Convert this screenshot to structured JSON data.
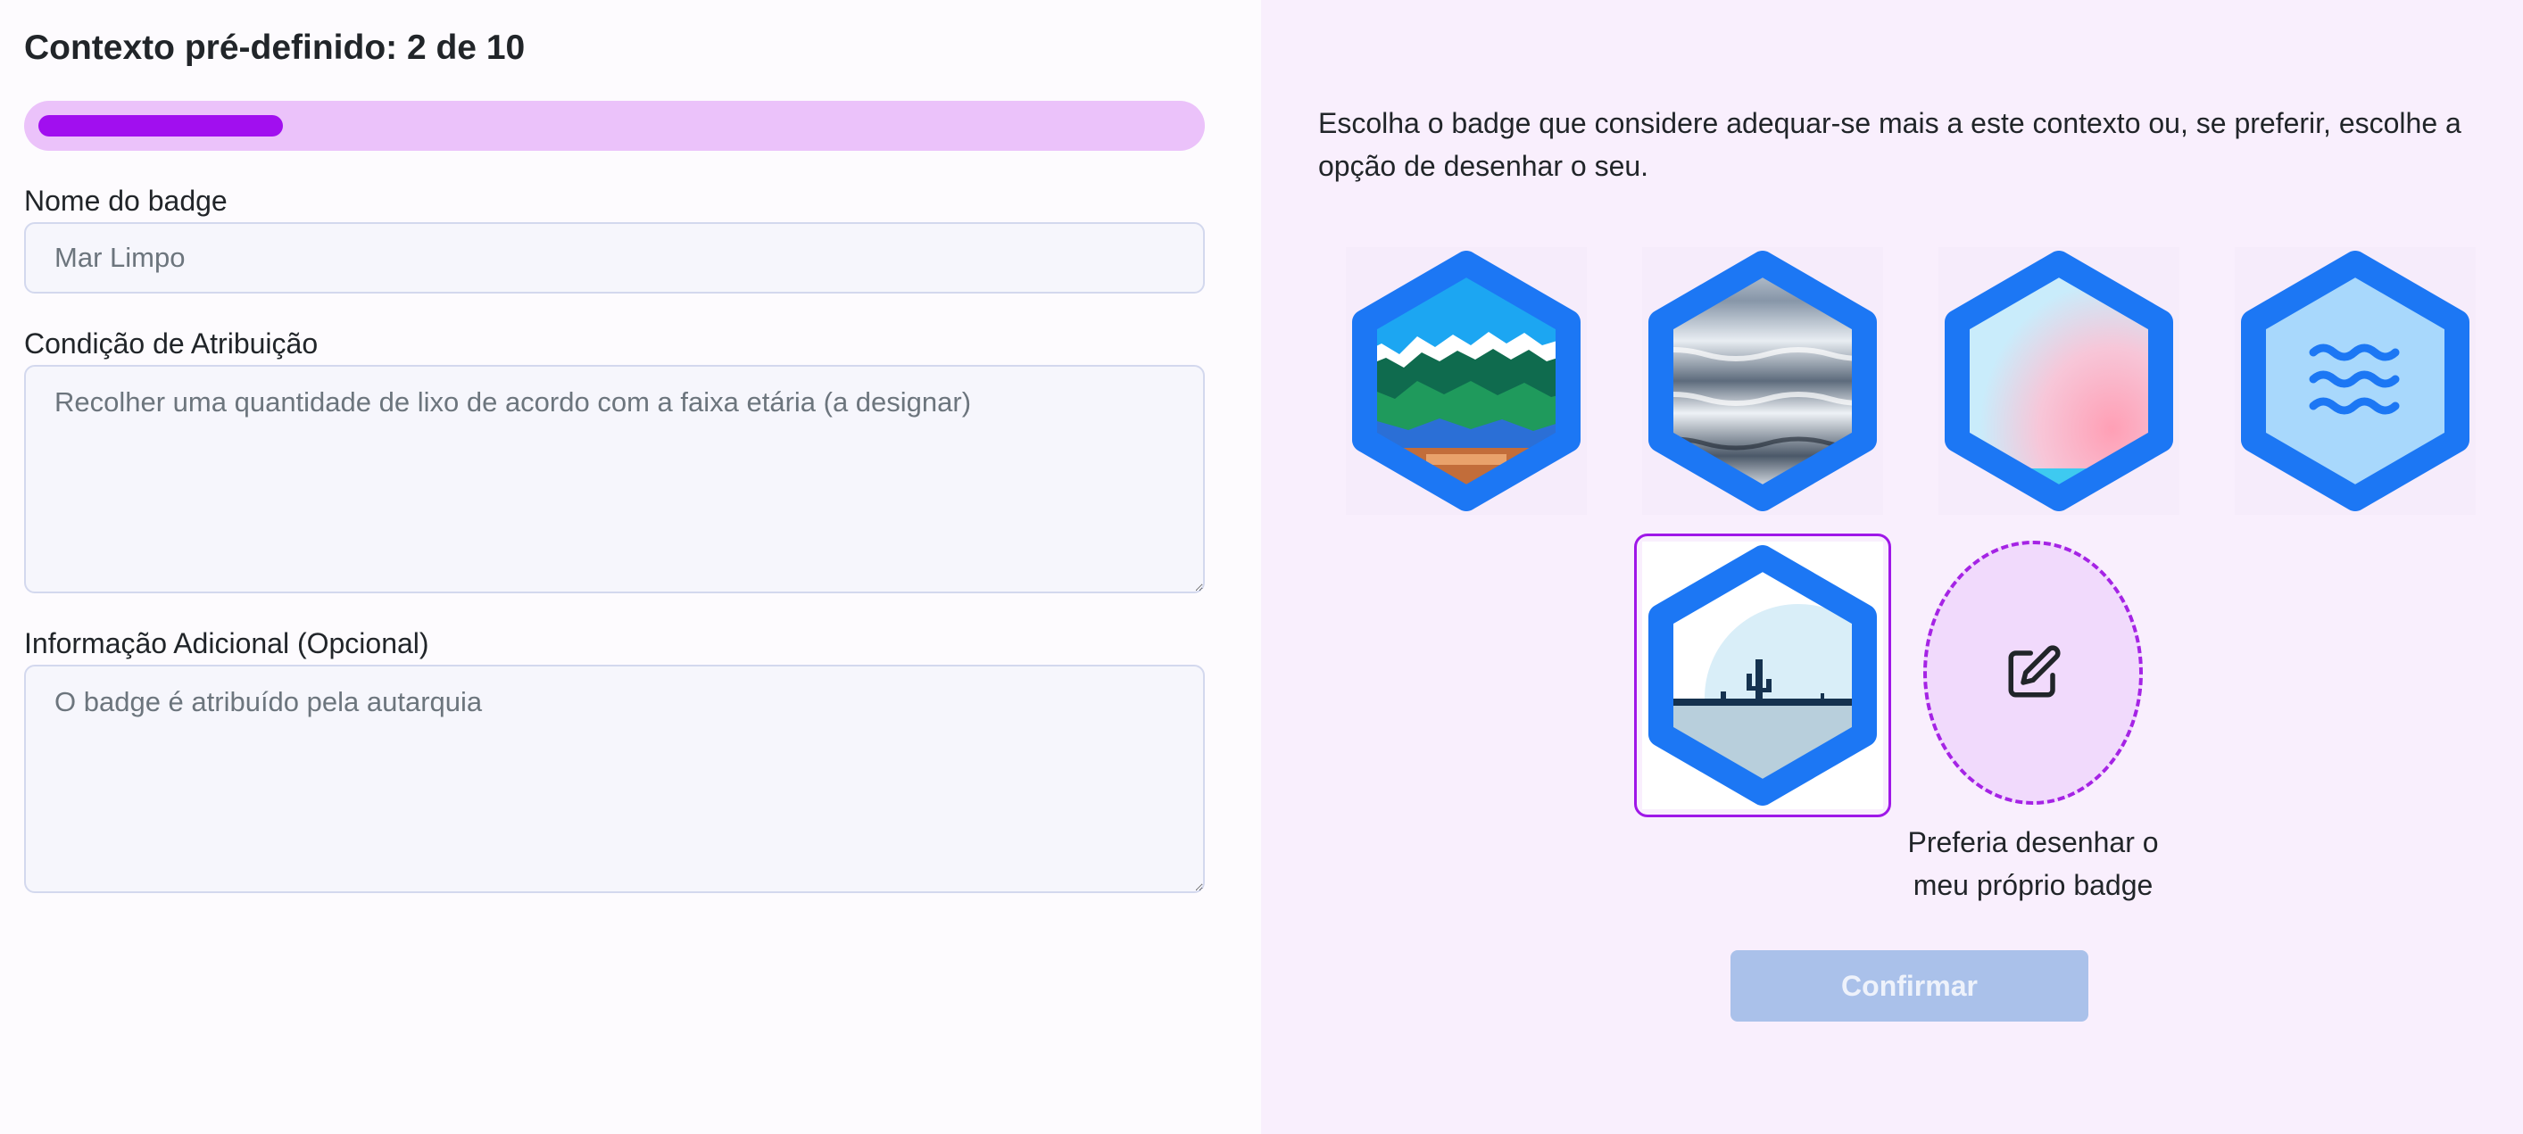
{
  "form": {
    "title": "Contexto pré-definido: 2 de 10",
    "progress": {
      "current": 2,
      "total": 10
    },
    "badge_name": {
      "label": "Nome do badge",
      "placeholder": "Mar Limpo"
    },
    "condition": {
      "label": "Condição de Atribuição",
      "placeholder": "Recolher uma quantidade de lixo de acordo com a faixa etária (a designar)"
    },
    "additional_info": {
      "label": "Informação Adicional (Opcional)",
      "placeholder": "O badge é atribuído pela autarquia"
    }
  },
  "badges": {
    "instructions": "Escolha o badge que considere adequar-se mais a este contexto ou, se preferir, escolhe a opção de desenhar o seu.",
    "options": [
      {
        "image": "pixel-art-sea-waves"
      },
      {
        "image": "water-ripples"
      },
      {
        "image": "pink-sun-gradient"
      },
      {
        "image": "waves-icon"
      },
      {
        "image": "cactus-horizon",
        "selected": true
      }
    ],
    "draw_own": {
      "label": "Preferia desenhar o meu próprio badge",
      "icon": "edit-icon"
    },
    "confirm_label": "Confirmar"
  },
  "colors": {
    "accent_purple": "#a10fef",
    "progress_track": "#ebc2fa",
    "hex_border": "#1c77f4",
    "confirm_disabled": "#aac1ea",
    "panel_background": "#f9effd"
  }
}
